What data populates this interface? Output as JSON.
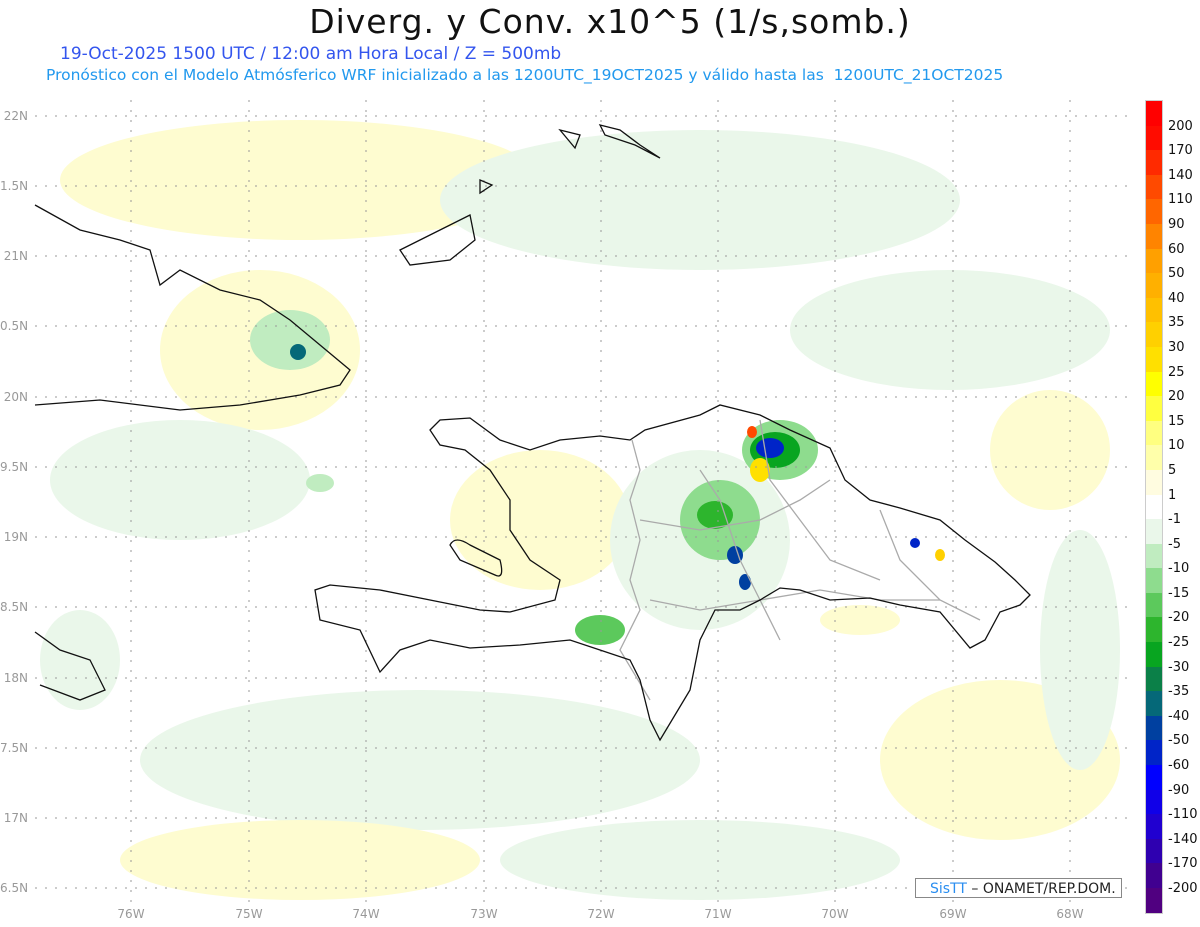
{
  "header": {
    "title": "Diverg. y Conv. x10^5 (1/s,somb.)",
    "subtitle": "19-Oct-2025  1500 UTC / 12:00 am Hora Local / Z = 500mb",
    "forecast_line": "Pronóstico con el Modelo Atmósferico WRF inicializado a las 1200UTC_19OCT2025 y válido hasta las  1200UTC_21OCT2025"
  },
  "axes": {
    "lat_labels": [
      "22N",
      "1.5N",
      "21N",
      "0.5N",
      "20N",
      "9.5N",
      "19N",
      "8.5N",
      "18N",
      "7.5N",
      "17N",
      "6.5N"
    ],
    "lon_labels": [
      "76W",
      "75W",
      "74W",
      "73W",
      "72W",
      "71W",
      "70W",
      "69W",
      "68W"
    ]
  },
  "legend": {
    "bins": [
      {
        "color": "#ff0000",
        "label": "200"
      },
      {
        "color": "#ff0c00",
        "label": "170"
      },
      {
        "color": "#ff2a00",
        "label": "140"
      },
      {
        "color": "#ff4a00",
        "label": "110"
      },
      {
        "color": "#ff6600",
        "label": "90"
      },
      {
        "color": "#ff8400",
        "label": "60"
      },
      {
        "color": "#ffa000",
        "label": "50"
      },
      {
        "color": "#ffb000",
        "label": "40"
      },
      {
        "color": "#ffc000",
        "label": "35"
      },
      {
        "color": "#ffd000",
        "label": "30"
      },
      {
        "color": "#ffe000",
        "label": "25"
      },
      {
        "color": "#ffff00",
        "label": "20"
      },
      {
        "color": "#ffff40",
        "label": "15"
      },
      {
        "color": "#ffff80",
        "label": "10"
      },
      {
        "color": "#ffffaa",
        "label": "5"
      },
      {
        "color": "#fffce0",
        "label": "1"
      },
      {
        "color": "#ffffff",
        "label": "-1"
      },
      {
        "color": "#eaf7ea",
        "label": "-5"
      },
      {
        "color": "#c0ecc0",
        "label": "-10"
      },
      {
        "color": "#8edc8e",
        "label": "-15"
      },
      {
        "color": "#5cc95c",
        "label": "-20"
      },
      {
        "color": "#2db52d",
        "label": "-25"
      },
      {
        "color": "#08a520",
        "label": "-30"
      },
      {
        "color": "#0b8048",
        "label": "-35"
      },
      {
        "color": "#056878",
        "label": "-40"
      },
      {
        "color": "#0040a0",
        "label": "-50"
      },
      {
        "color": "#0024c8",
        "label": "-60"
      },
      {
        "color": "#0000ff",
        "label": "-90"
      },
      {
        "color": "#1000e8",
        "label": "-110"
      },
      {
        "color": "#2000d0",
        "label": "-140"
      },
      {
        "color": "#2e00b0",
        "label": "-170"
      },
      {
        "color": "#400090",
        "label": "-200"
      },
      {
        "color": "#500080",
        "label": null
      }
    ]
  },
  "credit": {
    "logo": "SisTT",
    "text": " – ONAMET/REP.DOM."
  }
}
